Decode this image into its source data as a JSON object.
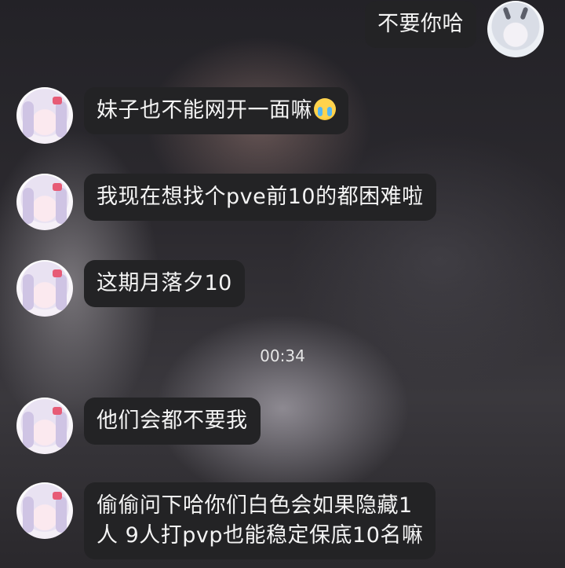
{
  "messages": [
    {
      "direction": "out",
      "text": "不要你哈"
    },
    {
      "direction": "in",
      "text": "妹子也不能网开一面嘛",
      "emoji": "crying-face"
    },
    {
      "direction": "in",
      "text": "我现在想找个pve前10的都困难啦"
    },
    {
      "direction": "in",
      "text": "这期月落夕10"
    },
    {
      "direction": "in",
      "text": "他们会都不要我"
    },
    {
      "direction": "in",
      "text": "偷偷问下哈你们白色会如果隐藏1\n人 9人打pvp也能稳定保底10名嘛"
    }
  ],
  "timestamp": "00:34"
}
